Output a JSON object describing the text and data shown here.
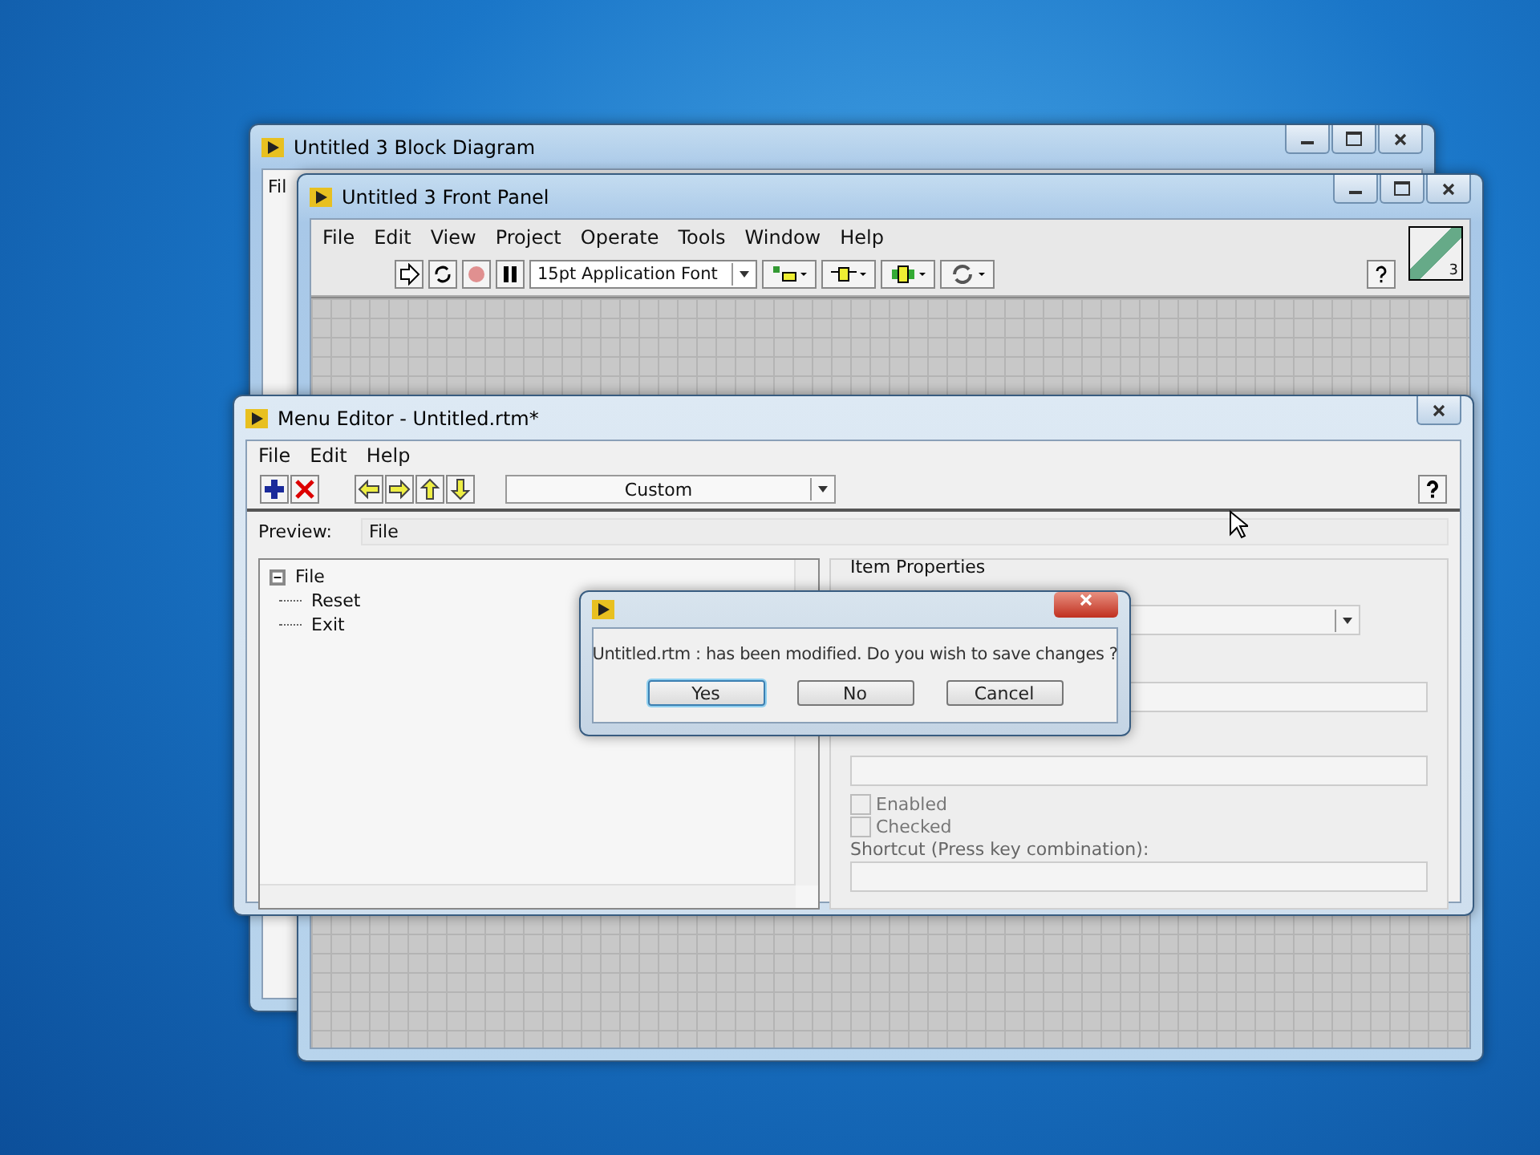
{
  "block_diagram": {
    "title": "Untitled 3 Block Diagram",
    "menus": [
      "Fil"
    ]
  },
  "front_panel": {
    "title": "Untitled 3 Front Panel",
    "menus": [
      "File",
      "Edit",
      "View",
      "Project",
      "Operate",
      "Tools",
      "Window",
      "Help"
    ],
    "font_select": "15pt Application Font",
    "vi_icon_number": "3"
  },
  "menu_editor": {
    "title": "Menu Editor - Untitled.rtm*",
    "menus": [
      "File",
      "Edit",
      "Help"
    ],
    "menu_type": "Custom",
    "preview_label": "Preview:",
    "preview_value": "File",
    "tree": [
      {
        "label": "File",
        "expanded": true,
        "children": [
          {
            "label": "Reset"
          },
          {
            "label": "Exit"
          }
        ]
      }
    ],
    "properties": {
      "title": "Item Properties",
      "checkboxes": [
        {
          "label": "Enabled",
          "checked": false
        },
        {
          "label": "Checked",
          "checked": false
        }
      ],
      "shortcut_label": "Shortcut (Press key combination):"
    }
  },
  "dialog": {
    "message": "Untitled.rtm : has been modified. Do you wish to save changes ?",
    "buttons": [
      {
        "label": "Yes",
        "selected": true
      },
      {
        "label": "No",
        "selected": false
      },
      {
        "label": "Cancel",
        "selected": false
      }
    ]
  }
}
